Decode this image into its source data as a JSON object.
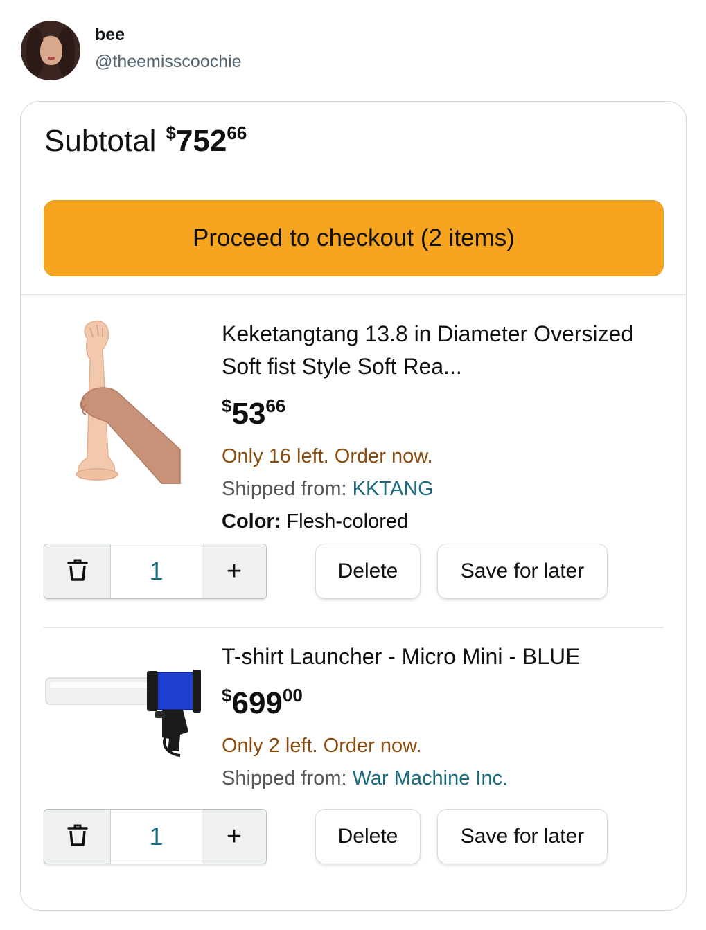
{
  "tweet": {
    "display_name": "bee",
    "handle": "@theemisscoochie"
  },
  "cart": {
    "subtotal_label": "Subtotal",
    "subtotal_dollar": "$",
    "subtotal_whole": "752",
    "subtotal_cents": "66",
    "checkout_label": "Proceed to checkout (2 items)",
    "items": [
      {
        "title": "Keketangtang 13.8 in Diameter Oversized Soft fist Style Soft Rea...",
        "price_dollar": "$",
        "price_whole": "53",
        "price_cents": "66",
        "stock": "Only 16 left. Order now.",
        "shipped_label": "Shipped from: ",
        "seller": "KKTANG",
        "color_label": "Color:",
        "color_value": " Flesh-colored",
        "quantity": "1",
        "plus": "+",
        "delete_label": "Delete",
        "save_label": "Save for later"
      },
      {
        "title": "T-shirt Launcher - Micro Mini - BLUE",
        "price_dollar": "$",
        "price_whole": "699",
        "price_cents": "00",
        "stock": "Only 2 left. Order now.",
        "shipped_label": "Shipped from: ",
        "seller": "War Machine Inc.",
        "quantity": "1",
        "plus": "+",
        "delete_label": "Delete",
        "save_label": "Save for later"
      }
    ]
  },
  "colors": {
    "checkout_button": "#f7a520",
    "stock_text": "#8a4b0f",
    "seller_link": "#1a6b80",
    "launcher_blue": "#1f3fd1"
  },
  "icons": [
    "trash-icon",
    "plus-icon"
  ]
}
